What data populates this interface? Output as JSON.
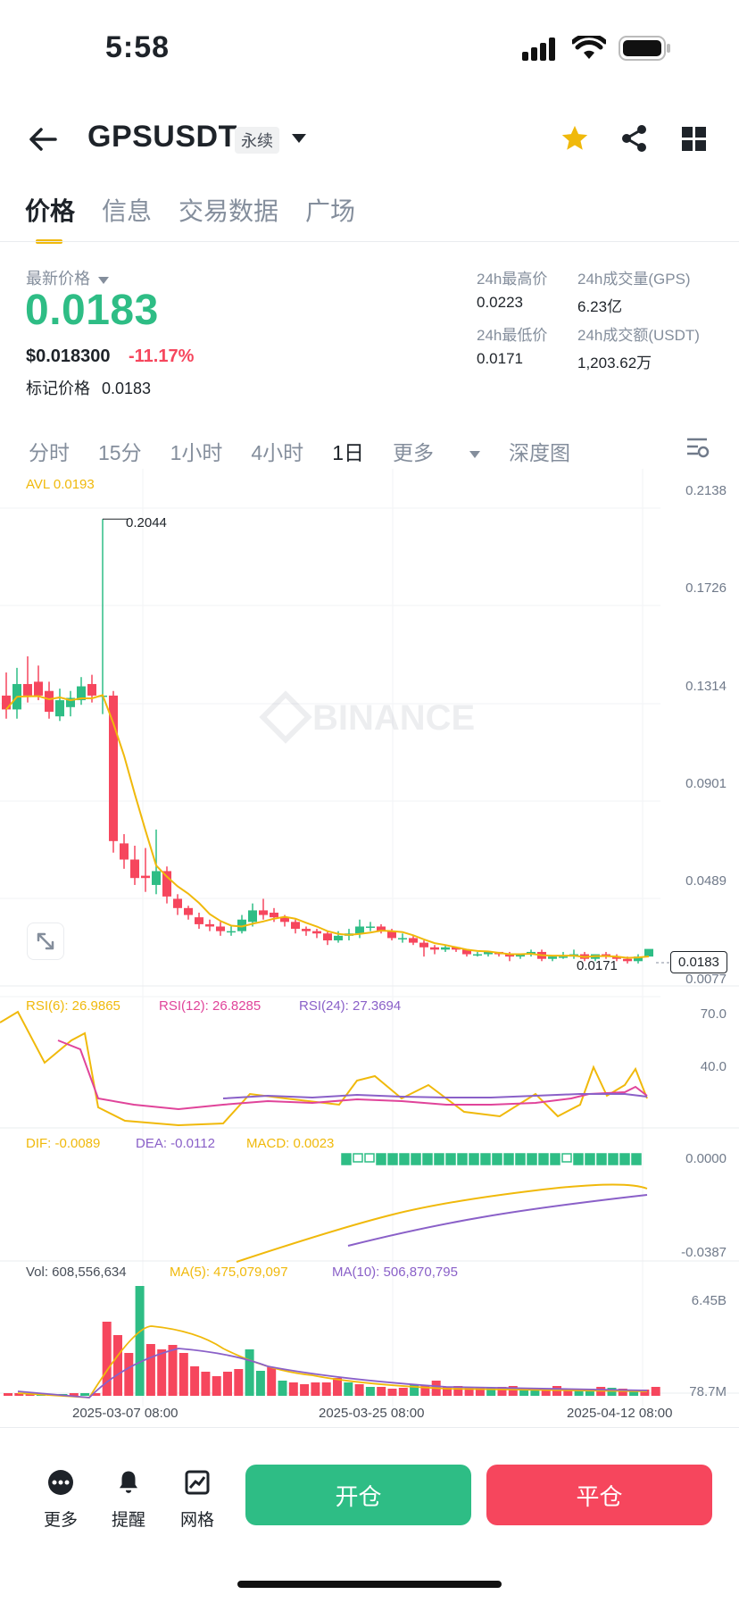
{
  "status_bar": {
    "time": "5:58"
  },
  "header": {
    "symbol": "GPSUSDT",
    "contract_type": "永续"
  },
  "tabs": [
    {
      "label": "价格",
      "active": true
    },
    {
      "label": "信息",
      "active": false
    },
    {
      "label": "交易数据",
      "active": false
    },
    {
      "label": "广场",
      "active": false
    }
  ],
  "ticker": {
    "last_price_label": "最新价格",
    "last_price": "0.0183",
    "usd_price": "$0.018300",
    "change_pct": "-11.17%",
    "mark_price_label": "标记价格",
    "mark_price": "0.0183",
    "high_label": "24h最高价",
    "high": "0.0223",
    "low_label": "24h最低价",
    "low": "0.0171",
    "volume_gps_label": "24h成交量(GPS)",
    "volume_gps": "6.23亿",
    "volume_usdt_label": "24h成交额(USDT)",
    "volume_usdt": "1,203.62万"
  },
  "intervals": [
    "分时",
    "15分",
    "1小时",
    "4小时",
    "1日",
    "更多",
    "深度图"
  ],
  "selected_interval": "1日",
  "colors": {
    "up": "#2ebd85",
    "down": "#f6465d",
    "accent": "#f0b90b",
    "purple": "#8a60c8",
    "pink": "#e0449a"
  },
  "chart": {
    "avl_label": "AVL 0.0193",
    "watermark": "BINANCE",
    "y_axis": [
      "0.2138",
      "0.1726",
      "0.1314",
      "0.0901",
      "0.0489",
      "0.0077"
    ],
    "high_annotation": "0.2044",
    "low_annotation": "0.0171",
    "current_price_tag": "0.0183",
    "rsi": {
      "rsi6": "RSI(6): 26.9865",
      "rsi12": "RSI(12): 26.8285",
      "rsi24": "RSI(24): 27.3694",
      "axis": [
        "70.0",
        "40.0"
      ]
    },
    "macd": {
      "dif": "DIF: -0.0089",
      "dea": "DEA: -0.0112",
      "macd": "MACD: 0.0023",
      "axis": [
        "0.0000",
        "-0.0387"
      ]
    },
    "volume": {
      "vol": "Vol: 608,556,634",
      "ma5": "MA(5): 475,079,097",
      "ma10": "MA(10): 506,870,795",
      "axis": [
        "6.45B",
        "78.7M"
      ]
    },
    "dates": [
      "2025-03-07 08:00",
      "2025-03-25 08:00",
      "2025-04-12 08:00"
    ]
  },
  "chart_data": {
    "type": "candlestick",
    "ylim": [
      0.0077,
      0.2138
    ],
    "candles": [
      {
        "o": 0.128,
        "h": 0.138,
        "l": 0.118,
        "c": 0.122
      },
      {
        "o": 0.122,
        "h": 0.14,
        "l": 0.118,
        "c": 0.133
      },
      {
        "o": 0.133,
        "h": 0.145,
        "l": 0.125,
        "c": 0.128
      },
      {
        "o": 0.134,
        "h": 0.141,
        "l": 0.126,
        "c": 0.128
      },
      {
        "o": 0.13,
        "h": 0.134,
        "l": 0.118,
        "c": 0.121
      },
      {
        "o": 0.119,
        "h": 0.131,
        "l": 0.117,
        "c": 0.126
      },
      {
        "o": 0.123,
        "h": 0.13,
        "l": 0.119,
        "c": 0.127
      },
      {
        "o": 0.126,
        "h": 0.136,
        "l": 0.124,
        "c": 0.132
      },
      {
        "o": 0.133,
        "h": 0.137,
        "l": 0.125,
        "c": 0.128
      },
      {
        "o": 0.128,
        "h": 0.2044,
        "l": 0.12,
        "c": 0.128
      },
      {
        "o": 0.128,
        "h": 0.13,
        "l": 0.06,
        "c": 0.065
      },
      {
        "o": 0.064,
        "h": 0.068,
        "l": 0.053,
        "c": 0.057
      },
      {
        "o": 0.057,
        "h": 0.063,
        "l": 0.046,
        "c": 0.049
      },
      {
        "o": 0.05,
        "h": 0.062,
        "l": 0.043,
        "c": 0.049
      },
      {
        "o": 0.046,
        "h": 0.07,
        "l": 0.042,
        "c": 0.052
      },
      {
        "o": 0.052,
        "h": 0.054,
        "l": 0.038,
        "c": 0.041
      },
      {
        "o": 0.04,
        "h": 0.042,
        "l": 0.033,
        "c": 0.036
      },
      {
        "o": 0.036,
        "h": 0.037,
        "l": 0.031,
        "c": 0.033
      },
      {
        "o": 0.032,
        "h": 0.034,
        "l": 0.027,
        "c": 0.029
      },
      {
        "o": 0.029,
        "h": 0.031,
        "l": 0.026,
        "c": 0.028
      },
      {
        "o": 0.028,
        "h": 0.03,
        "l": 0.024,
        "c": 0.026
      },
      {
        "o": 0.026,
        "h": 0.028,
        "l": 0.024,
        "c": 0.026
      },
      {
        "o": 0.026,
        "h": 0.033,
        "l": 0.025,
        "c": 0.031
      },
      {
        "o": 0.03,
        "h": 0.038,
        "l": 0.028,
        "c": 0.035
      },
      {
        "o": 0.035,
        "h": 0.04,
        "l": 0.031,
        "c": 0.033
      },
      {
        "o": 0.034,
        "h": 0.036,
        "l": 0.03,
        "c": 0.032
      },
      {
        "o": 0.032,
        "h": 0.033,
        "l": 0.028,
        "c": 0.03
      },
      {
        "o": 0.03,
        "h": 0.031,
        "l": 0.025,
        "c": 0.027
      },
      {
        "o": 0.027,
        "h": 0.028,
        "l": 0.024,
        "c": 0.026
      },
      {
        "o": 0.026,
        "h": 0.027,
        "l": 0.023,
        "c": 0.025
      },
      {
        "o": 0.025,
        "h": 0.026,
        "l": 0.02,
        "c": 0.022
      },
      {
        "o": 0.022,
        "h": 0.026,
        "l": 0.021,
        "c": 0.024
      },
      {
        "o": 0.024,
        "h": 0.027,
        "l": 0.022,
        "c": 0.025
      },
      {
        "o": 0.025,
        "h": 0.031,
        "l": 0.023,
        "c": 0.028
      },
      {
        "o": 0.028,
        "h": 0.03,
        "l": 0.026,
        "c": 0.028
      },
      {
        "o": 0.028,
        "h": 0.029,
        "l": 0.025,
        "c": 0.026
      },
      {
        "o": 0.026,
        "h": 0.027,
        "l": 0.022,
        "c": 0.023
      },
      {
        "o": 0.023,
        "h": 0.025,
        "l": 0.021,
        "c": 0.023
      },
      {
        "o": 0.023,
        "h": 0.024,
        "l": 0.02,
        "c": 0.021
      },
      {
        "o": 0.021,
        "h": 0.022,
        "l": 0.015,
        "c": 0.019
      },
      {
        "o": 0.019,
        "h": 0.02,
        "l": 0.016,
        "c": 0.018
      },
      {
        "o": 0.018,
        "h": 0.02,
        "l": 0.017,
        "c": 0.019
      },
      {
        "o": 0.019,
        "h": 0.019,
        "l": 0.017,
        "c": 0.018
      },
      {
        "o": 0.018,
        "h": 0.018,
        "l": 0.015,
        "c": 0.016
      },
      {
        "o": 0.016,
        "h": 0.017,
        "l": 0.015,
        "c": 0.016
      },
      {
        "o": 0.016,
        "h": 0.017,
        "l": 0.015,
        "c": 0.017
      },
      {
        "o": 0.017,
        "h": 0.017,
        "l": 0.015,
        "c": 0.016
      },
      {
        "o": 0.016,
        "h": 0.017,
        "l": 0.013,
        "c": 0.015
      },
      {
        "o": 0.015,
        "h": 0.016,
        "l": 0.014,
        "c": 0.016
      },
      {
        "o": 0.016,
        "h": 0.018,
        "l": 0.015,
        "c": 0.017
      },
      {
        "o": 0.017,
        "h": 0.018,
        "l": 0.013,
        "c": 0.014
      },
      {
        "o": 0.014,
        "h": 0.015,
        "l": 0.013,
        "c": 0.015
      },
      {
        "o": 0.015,
        "h": 0.017,
        "l": 0.014,
        "c": 0.015
      },
      {
        "o": 0.015,
        "h": 0.018,
        "l": 0.014,
        "c": 0.016
      },
      {
        "o": 0.016,
        "h": 0.017,
        "l": 0.013,
        "c": 0.014
      },
      {
        "o": 0.014,
        "h": 0.016,
        "l": 0.013,
        "c": 0.016
      },
      {
        "o": 0.016,
        "h": 0.017,
        "l": 0.014,
        "c": 0.015
      },
      {
        "o": 0.015,
        "h": 0.016,
        "l": 0.013,
        "c": 0.014
      },
      {
        "o": 0.014,
        "h": 0.015,
        "l": 0.012,
        "c": 0.013
      },
      {
        "o": 0.013,
        "h": 0.016,
        "l": 0.012,
        "c": 0.015
      },
      {
        "o": 0.015,
        "h": 0.016,
        "l": 0.0171,
        "c": 0.0183
      }
    ]
  }
}
